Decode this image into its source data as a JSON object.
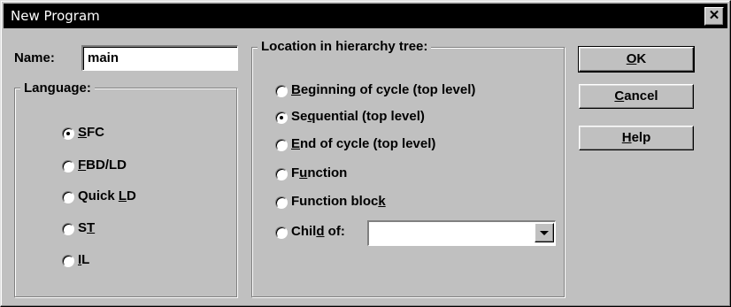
{
  "window": {
    "title": "New Program",
    "close_glyph": "✕"
  },
  "name_field": {
    "label": "Name:",
    "value": "main"
  },
  "language": {
    "legend": "Language:",
    "options": [
      {
        "pre": "",
        "u": "S",
        "post": "FC",
        "selected": true
      },
      {
        "pre": "",
        "u": "F",
        "post": "BD/LD",
        "selected": false
      },
      {
        "pre": "Quick ",
        "u": "L",
        "post": "D",
        "selected": false
      },
      {
        "pre": "S",
        "u": "T",
        "post": "",
        "selected": false
      },
      {
        "pre": "",
        "u": "I",
        "post": "L",
        "selected": false
      }
    ]
  },
  "location": {
    "legend": "Location in hierarchy tree:",
    "options": [
      {
        "pre": "",
        "u": "B",
        "post": "eginning of cycle (top level)",
        "selected": false
      },
      {
        "pre": "Se",
        "u": "q",
        "post": "uential (top level)",
        "selected": true
      },
      {
        "pre": "",
        "u": "E",
        "post": "nd of cycle (top level)",
        "selected": false
      },
      {
        "pre": "F",
        "u": "u",
        "post": "nction",
        "selected": false
      },
      {
        "pre": "Function bloc",
        "u": "k",
        "post": "",
        "selected": false
      },
      {
        "pre": "Chil",
        "u": "d",
        "post": " of:",
        "selected": false
      }
    ],
    "child_of_value": ""
  },
  "buttons": {
    "ok": {
      "pre": "",
      "u": "O",
      "post": "K"
    },
    "cancel": {
      "pre": "",
      "u": "C",
      "post": "ancel"
    },
    "help": {
      "pre": "",
      "u": "H",
      "post": "elp"
    }
  },
  "icons": {
    "close": "close-icon",
    "dropdown": "chevron-down-icon"
  }
}
